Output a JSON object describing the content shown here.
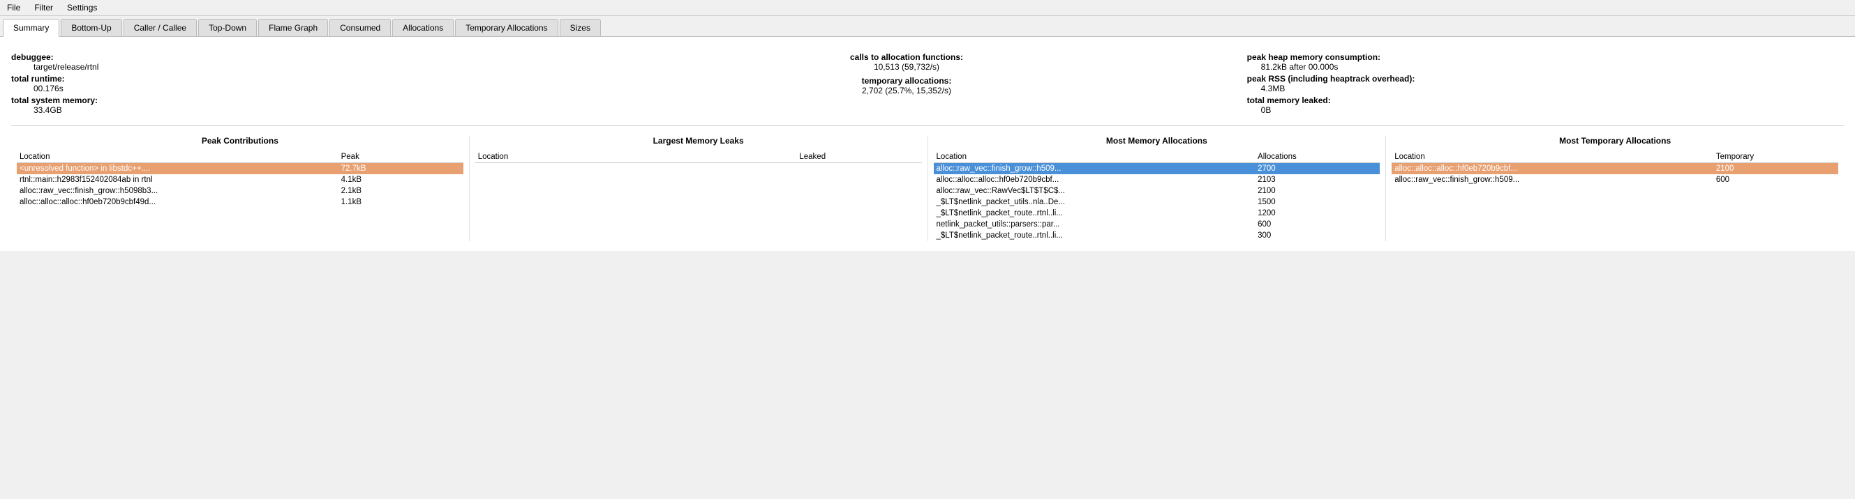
{
  "menubar": {
    "items": [
      "File",
      "Filter",
      "Settings"
    ]
  },
  "tabs": [
    {
      "label": "Summary",
      "active": true
    },
    {
      "label": "Bottom-Up",
      "active": false
    },
    {
      "label": "Caller / Callee",
      "active": false
    },
    {
      "label": "Top-Down",
      "active": false
    },
    {
      "label": "Flame Graph",
      "active": false
    },
    {
      "label": "Consumed",
      "active": false
    },
    {
      "label": "Allocations",
      "active": false
    },
    {
      "label": "Temporary Allocations",
      "active": false
    },
    {
      "label": "Sizes",
      "active": false
    }
  ],
  "info": {
    "debuggee_label": "debuggee:",
    "debuggee_value": "target/release/rtnl",
    "runtime_label": "total runtime:",
    "runtime_value": "00.176s",
    "system_memory_label": "total system memory:",
    "system_memory_value": "33.4GB",
    "calls_label": "calls to allocation functions:",
    "calls_value": "10,513 (59,732/s)",
    "temp_alloc_label": "temporary allocations:",
    "temp_alloc_value": "2,702 (25.7%, 15,352/s)",
    "peak_heap_label": "peak heap memory consumption:",
    "peak_heap_value": "81.2kB after 00.000s",
    "peak_rss_label": "peak RSS (including heaptrack overhead):",
    "peak_rss_value": "4.3MB",
    "total_leaked_label": "total memory leaked:",
    "total_leaked_value": "0B"
  },
  "peak_contributions": {
    "title": "Peak Contributions",
    "col_location": "Location",
    "col_peak": "Peak",
    "rows": [
      {
        "location": "<unresolved function> in libstdc++....",
        "peak": "72.7kB",
        "highlight": "orange"
      },
      {
        "location": "rtnl::main::h2983f152402084ab in rtnl",
        "peak": "4.1kB",
        "highlight": "none"
      },
      {
        "location": "alloc::raw_vec::finish_grow::h5098b3...",
        "peak": "2.1kB",
        "highlight": "none"
      },
      {
        "location": "alloc::alloc::alloc::hf0eb720b9cbf49d...",
        "peak": "1.1kB",
        "highlight": "none"
      }
    ]
  },
  "largest_memory_leaks": {
    "title": "Largest Memory Leaks",
    "col_location": "Location",
    "col_leaked": "Leaked",
    "rows": []
  },
  "most_memory_allocations": {
    "title": "Most Memory Allocations",
    "col_location": "Location",
    "col_allocs": "Allocations",
    "rows": [
      {
        "location": "alloc::raw_vec::finish_grow::h509...",
        "allocs": "2700",
        "highlight": "blue"
      },
      {
        "location": "alloc::alloc::alloc::hf0eb720b9cbf...",
        "allocs": "2103",
        "highlight": "none"
      },
      {
        "location": "alloc::raw_vec::RawVec$LT$T$C$...",
        "allocs": "2100",
        "highlight": "none"
      },
      {
        "location": "_$LT$netlink_packet_utils..nla..De...",
        "allocs": "1500",
        "highlight": "none"
      },
      {
        "location": "_$LT$netlink_packet_route..rtnl..li...",
        "allocs": "1200",
        "highlight": "none"
      },
      {
        "location": "netlink_packet_utils::parsers::par...",
        "allocs": "600",
        "highlight": "none"
      },
      {
        "location": "_$LT$netlink_packet_route..rtnl..li...",
        "allocs": "300",
        "highlight": "none"
      }
    ]
  },
  "most_temporary_allocations": {
    "title": "Most Temporary Allocations",
    "col_location": "Location",
    "col_temporary": "Temporary",
    "rows": [
      {
        "location": "alloc::alloc::alloc::hf0eb720b9cbf...",
        "temporary": "2100",
        "highlight": "orange"
      },
      {
        "location": "alloc::raw_vec::finish_grow::h509...",
        "temporary": "600",
        "highlight": "none"
      }
    ]
  }
}
